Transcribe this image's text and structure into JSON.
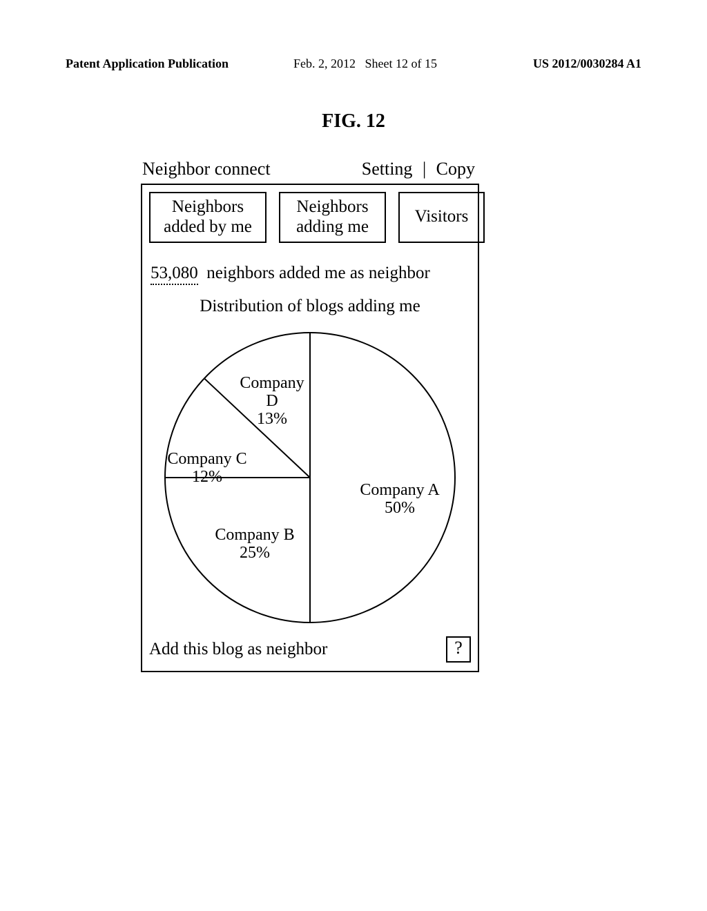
{
  "page_header": {
    "publication": "Patent Application Publication",
    "date": "Feb. 2, 2012",
    "sheet": "Sheet 12 of 15",
    "patno": "US 2012/0030284 A1"
  },
  "figure_title": "FIG. 12",
  "widget": {
    "title": "Neighbor connect",
    "link_setting": "Setting",
    "link_copy": "Copy",
    "tabs": {
      "added_by_me": "Neighbors added by me",
      "adding_me": "Neighbors adding me",
      "visitors": "Visitors"
    },
    "count_value": "53,080",
    "count_suffix": "neighbors added me as neighbor",
    "distribution_title": "Distribution of blogs adding me",
    "bottom_text": "Add this blog as neighbor",
    "help_label": "?"
  },
  "chart_data": {
    "type": "pie",
    "title": "Distribution of blogs adding me",
    "series": [
      {
        "name": "Company A",
        "value": 50,
        "label": "Company A 50%"
      },
      {
        "name": "Company B",
        "value": 25,
        "label": "Company B 25%"
      },
      {
        "name": "Company C",
        "value": 12,
        "label": "Company C 12%"
      },
      {
        "name": "Company D",
        "value": 13,
        "label": "Company D 13%"
      }
    ]
  }
}
